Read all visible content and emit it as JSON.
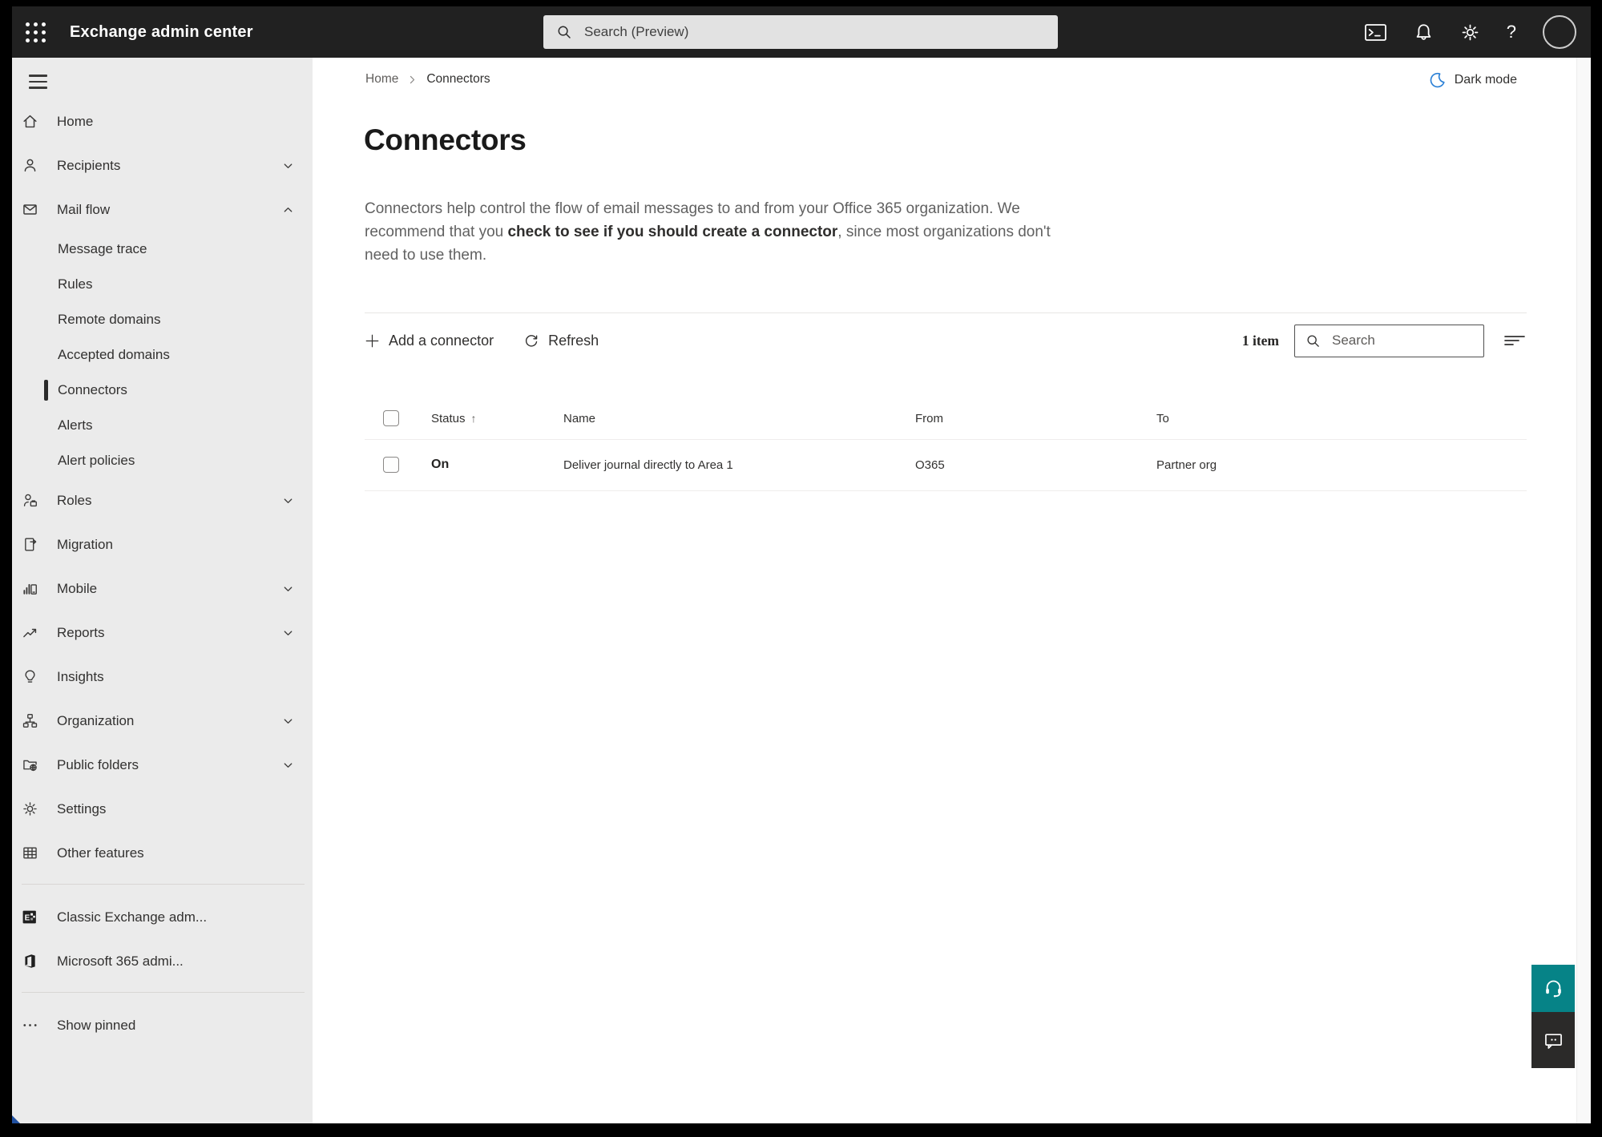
{
  "topbar": {
    "app_title": "Exchange admin center",
    "search_placeholder": "Search (Preview)"
  },
  "sidebar": {
    "items": [
      {
        "label": "Home",
        "icon": "home",
        "type": "top"
      },
      {
        "label": "Recipients",
        "icon": "person",
        "type": "top",
        "chevron": "down"
      },
      {
        "label": "Mail flow",
        "icon": "envelope",
        "type": "top",
        "chevron": "up",
        "expanded": true
      },
      {
        "label": "Message trace",
        "type": "sub"
      },
      {
        "label": "Rules",
        "type": "sub"
      },
      {
        "label": "Remote domains",
        "type": "sub"
      },
      {
        "label": "Accepted domains",
        "type": "sub"
      },
      {
        "label": "Connectors",
        "type": "sub",
        "selected": true
      },
      {
        "label": "Alerts",
        "type": "sub"
      },
      {
        "label": "Alert policies",
        "type": "sub"
      },
      {
        "label": "Roles",
        "icon": "roles",
        "type": "top",
        "chevron": "down"
      },
      {
        "label": "Migration",
        "icon": "migration",
        "type": "top"
      },
      {
        "label": "Mobile",
        "icon": "mobile",
        "type": "top",
        "chevron": "down"
      },
      {
        "label": "Reports",
        "icon": "reports",
        "type": "top",
        "chevron": "down"
      },
      {
        "label": "Insights",
        "icon": "lightbulb",
        "type": "top"
      },
      {
        "label": "Organization",
        "icon": "org-chart",
        "type": "top",
        "chevron": "down"
      },
      {
        "label": "Public folders",
        "icon": "folder-globe",
        "type": "top",
        "chevron": "down"
      },
      {
        "label": "Settings",
        "icon": "gear",
        "type": "top"
      },
      {
        "label": "Other features",
        "icon": "table-grid",
        "type": "top"
      },
      {
        "label": "Classic Exchange adm...",
        "icon": "exchange-logo",
        "type": "top"
      },
      {
        "label": "Microsoft 365 admi...",
        "icon": "office-logo",
        "type": "top"
      },
      {
        "label": "Show pinned",
        "icon": "ellipsis",
        "type": "top"
      }
    ]
  },
  "header": {
    "breadcrumb_home": "Home",
    "breadcrumb_current": "Connectors",
    "dark_mode_label": "Dark mode",
    "title": "Connectors",
    "description_before_link": "Connectors help control the flow of email messages to and from your Office 365 organization. We recommend that you ",
    "description_link": "check to see if you should create a connector",
    "description_after_link": ", since most organizations don't need to use them."
  },
  "toolbar": {
    "add_label": "Add a connector",
    "refresh_label": "Refresh",
    "item_count": "1 item",
    "search_placeholder": "Search"
  },
  "table": {
    "columns": {
      "status": "Status",
      "name": "Name",
      "from": "From",
      "to": "To"
    },
    "sort_arrow": "↑",
    "rows": [
      {
        "status": "On",
        "name": "Deliver journal directly to Area 1",
        "from": "O365",
        "to": "Partner org"
      }
    ]
  },
  "colors": {
    "topbar_bg": "#212121",
    "sidebar_bg": "#ebebeb",
    "accent_teal": "#068387",
    "dark_mode_blue": "#2b80d6",
    "text_dark": "#323130",
    "text_gray": "#605e5c"
  }
}
